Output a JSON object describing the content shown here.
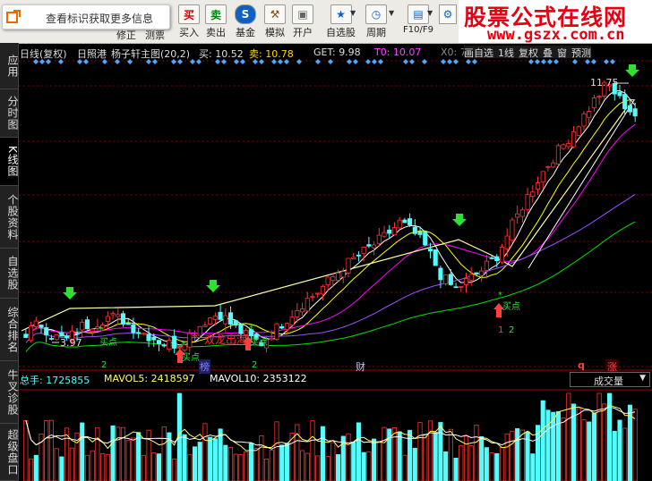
{
  "toolbar": {
    "notice_text": "查看标识获取更多信息",
    "hidden_labels": [
      "修正",
      "测票"
    ],
    "buttons": [
      {
        "label": "买入",
        "icon": "买",
        "color": "#d00000"
      },
      {
        "label": "卖出",
        "icon": "卖",
        "color": "#008000"
      },
      {
        "label": "基金",
        "icon": "S",
        "color": "#1060c0"
      },
      {
        "label": "模拟",
        "icon": "⚒",
        "color": "#8a4a10"
      },
      {
        "label": "开户",
        "icon": "🔒",
        "color": "#666"
      },
      {
        "label": "自选股",
        "icon": "★",
        "color": "#1060c0"
      },
      {
        "label": "周期",
        "icon": "◷",
        "color": "#1060c0"
      },
      {
        "label": "F10/F9",
        "icon": "▤",
        "color": "#1060c0"
      }
    ]
  },
  "brand": {
    "title": "股票公式在线网",
    "url": "www.gszx.com.cn"
  },
  "sidebar": {
    "items": [
      {
        "label": "应用"
      },
      {
        "label": "分时图"
      },
      {
        "label": "K线图",
        "active": true
      },
      {
        "label": "个股资料"
      },
      {
        "label": "自选股"
      },
      {
        "label": "综合排名"
      },
      {
        "label": "牛叉诊股"
      },
      {
        "label": "超级盘口"
      }
    ]
  },
  "chart_header": {
    "period": "日线(复权)",
    "stock": "日照港",
    "formula": "杨子轩主图(20,2)",
    "buy_label": "买: 10.52",
    "sell_label": "卖: 10.78",
    "get_label": "GET: 9.98",
    "t0_label": "T0: 10.07",
    "x0_label": "X0: 7",
    "right_menu": [
      "画自选",
      "1线",
      "复权",
      "叠",
      "窗",
      "预测"
    ]
  },
  "annotations": {
    "high_price": "11.75",
    "low_price": "3.97",
    "double_dragon": "双龙出海",
    "event_tags": [
      {
        "text": "榜",
        "color": "#8080ff",
        "bg": "#202060"
      },
      {
        "text": "财",
        "color": "#c0c0ff",
        "bg": "#000"
      },
      {
        "text": "q",
        "color": "#ff4040",
        "bg": "#000"
      },
      {
        "text": "涨",
        "color": "#ff4040",
        "bg": "#3a0000"
      }
    ],
    "buy_point_text": "买点",
    "buy_point_numbers": [
      "2",
      "1",
      "2",
      "2"
    ],
    "asterisk": "*"
  },
  "volume_header": {
    "total_label": "总手: 1725855",
    "mavol5_label": "MAVOL5: 2418597",
    "mavol10_label": "MAVOL10: 2353122",
    "dropdown_value": "成交量"
  },
  "colors": {
    "up": "#ff3232",
    "down": "#54fcfc",
    "ma_white": "#ffffff",
    "ma_yellow": "#ffff00",
    "ma_magenta": "#ff00ff",
    "ma_green": "#00e000",
    "grid": "#800000"
  },
  "chart_data": {
    "type": "candlestick",
    "series": [
      {
        "name": "K线",
        "ohlc_close_approx": [
          4.3,
          4.6,
          4.2,
          4.1,
          4.5,
          4.6,
          4.8,
          4.7,
          4.4,
          4.2,
          4.0,
          3.97,
          4.3,
          4.7,
          4.9,
          4.5,
          4.2,
          4.0,
          4.4,
          4.8,
          5.2,
          5.5,
          5.9,
          6.3,
          6.6,
          6.9,
          7.2,
          7.6,
          7.3,
          6.8,
          6.0,
          5.6,
          5.9,
          6.2,
          6.6,
          7.4,
          8.2,
          8.9,
          9.5,
          10.0,
          10.6,
          11.2,
          11.75,
          11.2,
          10.8
        ]
      }
    ],
    "y_range": [
      3.97,
      11.75
    ]
  }
}
